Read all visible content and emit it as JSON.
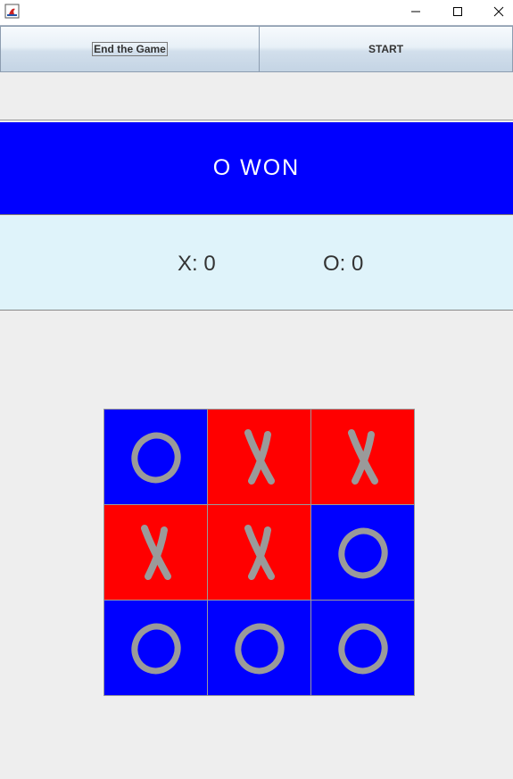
{
  "colors": {
    "o_cell": "#0000ff",
    "x_cell": "#ff0000",
    "mark": "#9a9a9a",
    "banner": "#0000ff",
    "score_bg": "#dff3fa"
  },
  "window": {
    "app_icon": "java-app-icon",
    "controls": [
      "minimize-icon",
      "maximize-icon",
      "close-icon"
    ]
  },
  "toolbar": {
    "end_label": "End the Game",
    "start_label": "START"
  },
  "banner": {
    "text": "O WON"
  },
  "score": {
    "x_text": "X: 0",
    "o_text": "O: 0"
  },
  "board": {
    "cells": [
      "O",
      "X",
      "X",
      "X",
      "X",
      "O",
      "O",
      "O",
      "O"
    ]
  }
}
